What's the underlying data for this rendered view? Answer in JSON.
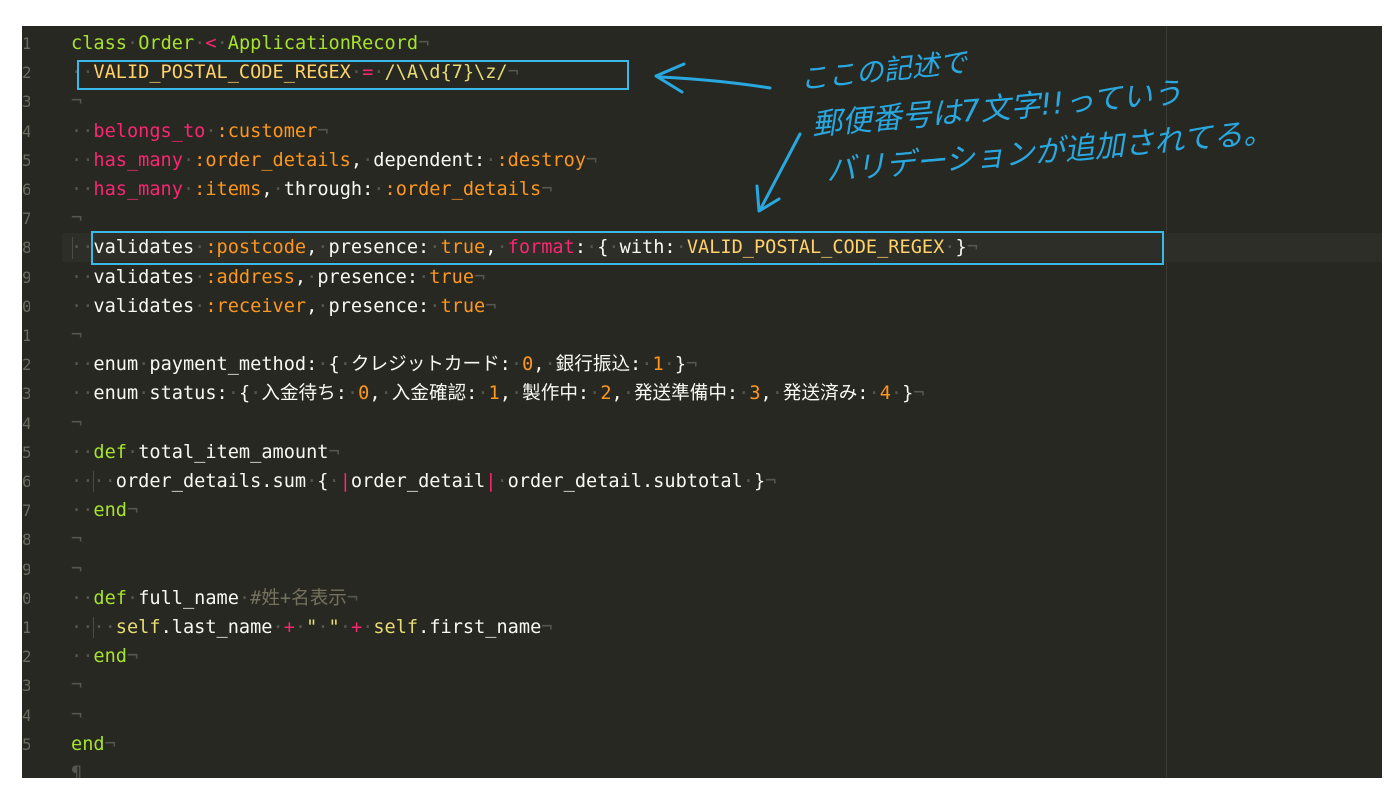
{
  "code_lines": [
    {
      "n": "1",
      "parts": [
        [
          "kw",
          "class"
        ],
        [
          "inv",
          "·"
        ],
        [
          "cls",
          "Order"
        ],
        [
          "inv",
          "·"
        ],
        [
          "op",
          "<"
        ],
        [
          "inv",
          "·"
        ],
        [
          "cls",
          "ApplicationRecord"
        ],
        [
          "inv",
          "¬"
        ]
      ]
    },
    {
      "n": "2",
      "parts": [
        [
          "inv",
          "··"
        ],
        [
          "const",
          "VALID_POSTAL_CODE_REGEX"
        ],
        [
          "inv",
          "·"
        ],
        [
          "op",
          "="
        ],
        [
          "inv",
          "·"
        ],
        [
          "str",
          "/\\A\\d{7}\\z/"
        ],
        [
          "inv",
          "¬"
        ]
      ]
    },
    {
      "n": "3",
      "parts": [
        [
          "inv",
          "¬"
        ]
      ]
    },
    {
      "n": "4",
      "parts": [
        [
          "inv",
          "··"
        ],
        [
          "red",
          "belongs_to"
        ],
        [
          "inv",
          "·"
        ],
        [
          "sym",
          ":customer"
        ],
        [
          "inv",
          "¬"
        ]
      ]
    },
    {
      "n": "5",
      "parts": [
        [
          "inv",
          "··"
        ],
        [
          "red",
          "has_many"
        ],
        [
          "inv",
          "·"
        ],
        [
          "sym",
          ":order_details"
        ],
        [
          "call",
          ","
        ],
        [
          "inv",
          "·"
        ],
        [
          "call",
          "dependent:"
        ],
        [
          "inv",
          "·"
        ],
        [
          "sym",
          ":destroy"
        ],
        [
          "inv",
          "¬"
        ]
      ]
    },
    {
      "n": "6",
      "parts": [
        [
          "inv",
          "··"
        ],
        [
          "red",
          "has_many"
        ],
        [
          "inv",
          "·"
        ],
        [
          "sym",
          ":items"
        ],
        [
          "call",
          ","
        ],
        [
          "inv",
          "·"
        ],
        [
          "call",
          "through:"
        ],
        [
          "inv",
          "·"
        ],
        [
          "sym",
          ":order_details"
        ],
        [
          "inv",
          "¬"
        ]
      ]
    },
    {
      "n": "7",
      "parts": [
        [
          "inv",
          "¬"
        ]
      ]
    },
    {
      "n": "8",
      "parts": [
        [
          "inv",
          "··"
        ],
        [
          "call",
          "validates"
        ],
        [
          "inv",
          "·"
        ],
        [
          "sym",
          ":postcode"
        ],
        [
          "call",
          ","
        ],
        [
          "inv",
          "·"
        ],
        [
          "call",
          "presence:"
        ],
        [
          "inv",
          "·"
        ],
        [
          "bool",
          "true"
        ],
        [
          "call",
          ","
        ],
        [
          "inv",
          "·"
        ],
        [
          "red",
          "format"
        ],
        [
          "call",
          ":"
        ],
        [
          "inv",
          "·"
        ],
        [
          "call",
          "{"
        ],
        [
          "inv",
          "·"
        ],
        [
          "call",
          "with:"
        ],
        [
          "inv",
          "·"
        ],
        [
          "const",
          "VALID_POSTAL_CODE_REGEX"
        ],
        [
          "inv",
          "·"
        ],
        [
          "call",
          "}"
        ],
        [
          "inv",
          "¬"
        ]
      ]
    },
    {
      "n": "9",
      "parts": [
        [
          "inv",
          "··"
        ],
        [
          "call",
          "validates"
        ],
        [
          "inv",
          "·"
        ],
        [
          "sym",
          ":address"
        ],
        [
          "call",
          ","
        ],
        [
          "inv",
          "·"
        ],
        [
          "call",
          "presence:"
        ],
        [
          "inv",
          "·"
        ],
        [
          "bool",
          "true"
        ],
        [
          "inv",
          "¬"
        ]
      ]
    },
    {
      "n": "0",
      "parts": [
        [
          "inv",
          "··"
        ],
        [
          "call",
          "validates"
        ],
        [
          "inv",
          "·"
        ],
        [
          "sym",
          ":receiver"
        ],
        [
          "call",
          ","
        ],
        [
          "inv",
          "·"
        ],
        [
          "call",
          "presence:"
        ],
        [
          "inv",
          "·"
        ],
        [
          "bool",
          "true"
        ],
        [
          "inv",
          "¬"
        ]
      ]
    },
    {
      "n": "1",
      "parts": [
        [
          "inv",
          "¬"
        ]
      ]
    },
    {
      "n": "2",
      "parts": [
        [
          "inv",
          "··"
        ],
        [
          "call",
          "enum"
        ],
        [
          "inv",
          "·"
        ],
        [
          "call",
          "payment_method:"
        ],
        [
          "inv",
          "·"
        ],
        [
          "call",
          "{"
        ],
        [
          "inv",
          "·"
        ],
        [
          "call",
          "クレジットカード:"
        ],
        [
          "inv",
          "·"
        ],
        [
          "num",
          "0"
        ],
        [
          "call",
          ","
        ],
        [
          "inv",
          "·"
        ],
        [
          "call",
          "銀行振込:"
        ],
        [
          "inv",
          "·"
        ],
        [
          "num",
          "1"
        ],
        [
          "inv",
          "·"
        ],
        [
          "call",
          "}"
        ],
        [
          "inv",
          "¬"
        ]
      ]
    },
    {
      "n": "3",
      "parts": [
        [
          "inv",
          "··"
        ],
        [
          "call",
          "enum"
        ],
        [
          "inv",
          "·"
        ],
        [
          "call",
          "status:"
        ],
        [
          "inv",
          "·"
        ],
        [
          "call",
          "{"
        ],
        [
          "inv",
          "·"
        ],
        [
          "call",
          "入金待ち:"
        ],
        [
          "inv",
          "·"
        ],
        [
          "num",
          "0"
        ],
        [
          "call",
          ","
        ],
        [
          "inv",
          "·"
        ],
        [
          "call",
          "入金確認:"
        ],
        [
          "inv",
          "·"
        ],
        [
          "num",
          "1"
        ],
        [
          "call",
          ","
        ],
        [
          "inv",
          "·"
        ],
        [
          "call",
          "製作中:"
        ],
        [
          "inv",
          "·"
        ],
        [
          "num",
          "2"
        ],
        [
          "call",
          ","
        ],
        [
          "inv",
          "·"
        ],
        [
          "call",
          "発送準備中:"
        ],
        [
          "inv",
          "·"
        ],
        [
          "num",
          "3"
        ],
        [
          "call",
          ","
        ],
        [
          "inv",
          "·"
        ],
        [
          "call",
          "発送済み:"
        ],
        [
          "inv",
          "·"
        ],
        [
          "num",
          "4"
        ],
        [
          "inv",
          "·"
        ],
        [
          "call",
          "}"
        ],
        [
          "inv",
          "¬"
        ]
      ]
    },
    {
      "n": "4",
      "parts": [
        [
          "inv",
          "¬"
        ]
      ]
    },
    {
      "n": "5",
      "parts": [
        [
          "inv",
          "··"
        ],
        [
          "kw",
          "def"
        ],
        [
          "inv",
          "·"
        ],
        [
          "call",
          "total_item_amount"
        ],
        [
          "inv",
          "¬"
        ]
      ]
    },
    {
      "n": "6",
      "parts": [
        [
          "inv",
          "····"
        ],
        [
          "call",
          "order_details.sum"
        ],
        [
          "inv",
          "·"
        ],
        [
          "call",
          "{"
        ],
        [
          "inv",
          "·"
        ],
        [
          "red",
          "|"
        ],
        [
          "call",
          "order_detail"
        ],
        [
          "red",
          "|"
        ],
        [
          "inv",
          "·"
        ],
        [
          "call",
          "order_detail.subtotal"
        ],
        [
          "inv",
          "·"
        ],
        [
          "call",
          "}"
        ],
        [
          "inv",
          "¬"
        ]
      ]
    },
    {
      "n": "7",
      "parts": [
        [
          "inv",
          "··"
        ],
        [
          "kw",
          "end"
        ],
        [
          "inv",
          "¬"
        ]
      ]
    },
    {
      "n": "8",
      "parts": [
        [
          "inv",
          "¬"
        ]
      ]
    },
    {
      "n": "9",
      "parts": [
        [
          "inv",
          "¬"
        ]
      ]
    },
    {
      "n": "0",
      "parts": [
        [
          "inv",
          "··"
        ],
        [
          "kw",
          "def"
        ],
        [
          "inv",
          "·"
        ],
        [
          "call",
          "full_name"
        ],
        [
          "inv",
          "·"
        ],
        [
          "cmt",
          "#姓+名表示"
        ],
        [
          "inv",
          "¬"
        ]
      ]
    },
    {
      "n": "1",
      "parts": [
        [
          "inv",
          "····"
        ],
        [
          "self",
          "self"
        ],
        [
          "call",
          ".last_name"
        ],
        [
          "inv",
          "·"
        ],
        [
          "op",
          "+"
        ],
        [
          "inv",
          "·"
        ],
        [
          "str",
          "\""
        ],
        [
          "inv",
          "·"
        ],
        [
          "str",
          "\""
        ],
        [
          "inv",
          "·"
        ],
        [
          "op",
          "+"
        ],
        [
          "inv",
          "·"
        ],
        [
          "self",
          "self"
        ],
        [
          "call",
          ".first_name"
        ],
        [
          "inv",
          "¬"
        ]
      ]
    },
    {
      "n": "2",
      "parts": [
        [
          "inv",
          "··"
        ],
        [
          "kw",
          "end"
        ],
        [
          "inv",
          "¬"
        ]
      ]
    },
    {
      "n": "3",
      "parts": [
        [
          "inv",
          "¬"
        ]
      ]
    },
    {
      "n": "4",
      "parts": [
        [
          "inv",
          "¬"
        ]
      ]
    },
    {
      "n": "5",
      "parts": [
        [
          "kw",
          "end"
        ],
        [
          "inv",
          "¬"
        ]
      ]
    },
    {
      "n": "",
      "parts": [
        [
          "inv",
          "¶"
        ]
      ]
    }
  ],
  "annotation": {
    "line1": "ここの記述で",
    "line2": "郵便番号は7文字!!っていう",
    "line3": "バリデーションが追加されてる。"
  },
  "colors": {
    "background": "#272822",
    "highlight_box": "#3ab8e8",
    "annotation": "#29a8e0"
  }
}
